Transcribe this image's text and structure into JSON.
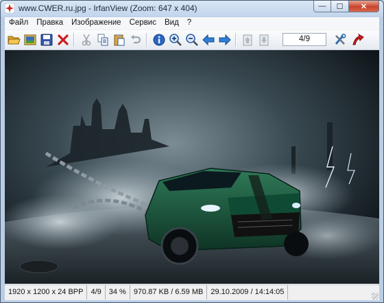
{
  "window": {
    "title": "www.CWER.ru.jpg - IrfanView (Zoom: 647 x 404)",
    "icon": "irfanview-app-icon",
    "buttons": {
      "minimize": "—",
      "maximize": "☐",
      "close": "✕"
    }
  },
  "menu": [
    "Файл",
    "Правка",
    "Изображение",
    "Сервис",
    "Вид",
    "?"
  ],
  "toolbar": {
    "buttons": [
      "open-folder-icon",
      "thumbnails-icon",
      "save-icon",
      "delete-icon",
      "cut-icon",
      "copy-icon",
      "paste-icon",
      "undo-icon",
      "info-icon",
      "zoom-in-icon",
      "zoom-out-icon",
      "previous-icon",
      "next-icon",
      "first-page-icon",
      "last-page-icon",
      "settings-icon",
      "exit-icon"
    ],
    "page_indicator": "4/9"
  },
  "image": {
    "description_icon": "car-wallpaper-image"
  },
  "statusbar": {
    "dimensions": "1920 x 1200 x 24 BPP",
    "index": "4/9",
    "zoom": "34 %",
    "size": "970.87 KB / 6.59 MB",
    "datetime": "29.10.2009 / 14:14:05"
  },
  "colors": {
    "accent": "#2f6fb6",
    "close_button": "#c8442c",
    "image_background": "#0d1419"
  }
}
